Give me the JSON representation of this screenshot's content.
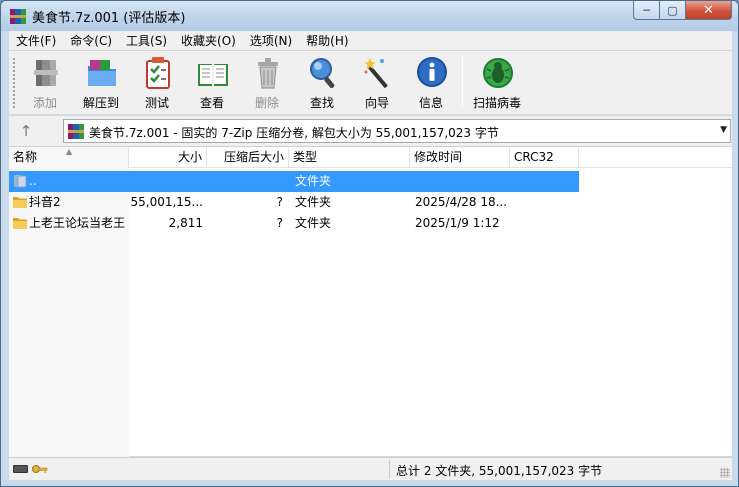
{
  "window": {
    "title": "美食节.7z.001 (评估版本)",
    "controls": {
      "minimize": "─",
      "maximize": "▢",
      "close": "✕"
    }
  },
  "menu": [
    "文件(F)",
    "命令(C)",
    "工具(S)",
    "收藏夹(O)",
    "选项(N)",
    "帮助(H)"
  ],
  "toolbar": {
    "buttons": [
      {
        "label": "添加",
        "icon": "add-archive-icon",
        "enabled": false
      },
      {
        "label": "解压到",
        "icon": "extract-to-icon",
        "enabled": true
      },
      {
        "label": "测试",
        "icon": "test-icon",
        "enabled": true
      },
      {
        "label": "查看",
        "icon": "view-book-icon",
        "enabled": true
      },
      {
        "label": "删除",
        "icon": "delete-trash-icon",
        "enabled": false
      },
      {
        "label": "查找",
        "icon": "find-magnifier-icon",
        "enabled": true
      },
      {
        "label": "向导",
        "icon": "wizard-wand-icon",
        "enabled": true
      },
      {
        "label": "信息",
        "icon": "info-icon",
        "enabled": true
      },
      {
        "label": "扫描病毒",
        "icon": "virus-scan-icon",
        "enabled": true
      }
    ]
  },
  "address": {
    "up_icon": "↑",
    "text": "美食节.7z.001 - 固实的 7-Zip 压缩分卷, 解包大小为 55,001,157,023 字节",
    "dropdown": "▼"
  },
  "columns": {
    "name": "名称",
    "size": "大小",
    "packed": "压缩后大小",
    "type": "类型",
    "modified": "修改时间",
    "crc": "CRC32"
  },
  "rows": [
    {
      "name": "..",
      "size": "",
      "packed": "",
      "type": "文件夹",
      "modified": "",
      "crc": "",
      "icon": "parent-folder-icon",
      "selected": true
    },
    {
      "name": "抖音2",
      "size": "55,001,15...",
      "packed": "?",
      "type": "文件夹",
      "modified": "2025/4/28 18...",
      "crc": "",
      "icon": "folder-icon",
      "selected": false
    },
    {
      "name": "上老王论坛当老王",
      "size": "2,811",
      "packed": "?",
      "type": "文件夹",
      "modified": "2025/1/9 1:12",
      "crc": "",
      "icon": "folder-icon",
      "selected": false
    }
  ],
  "status": {
    "text": "总计 2 文件夹, 55,001,157,023 字节"
  },
  "colors": {
    "selection": "#3399ff",
    "titlebar": "#bdd3ea",
    "close_button": "#c8472f"
  }
}
